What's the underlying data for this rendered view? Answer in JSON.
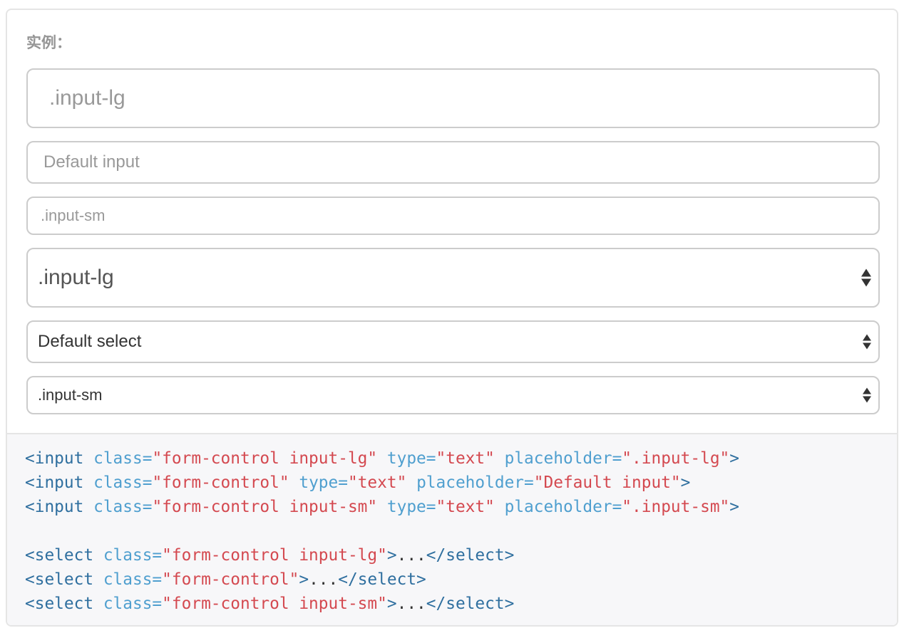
{
  "example": {
    "label": "实例："
  },
  "inputs": [
    {
      "placeholder": ".input-lg",
      "value": ""
    },
    {
      "placeholder": "Default input",
      "value": ""
    },
    {
      "placeholder": ".input-sm",
      "value": ""
    }
  ],
  "selects": [
    {
      "selected": ".input-lg"
    },
    {
      "selected": "Default select"
    },
    {
      "selected": ".input-sm"
    }
  ],
  "code": {
    "line1": {
      "open": "<input",
      "attr1": "class=",
      "val1": "\"form-control input-lg\"",
      "attr2": "type=",
      "val2": "\"text\"",
      "attr3": "placeholder=",
      "val3": "\".input-lg\"",
      "close": ">"
    },
    "line2": {
      "open": "<input",
      "attr1": "class=",
      "val1": "\"form-control\"",
      "attr2": "type=",
      "val2": "\"text\"",
      "attr3": "placeholder=",
      "val3": "\"Default input\"",
      "close": ">"
    },
    "line3": {
      "open": "<input",
      "attr1": "class=",
      "val1": "\"form-control input-sm\"",
      "attr2": "type=",
      "val2": "\"text\"",
      "attr3": "placeholder=",
      "val3": "\".input-sm\"",
      "close": ">"
    },
    "line4": {
      "open": "<select",
      "attr1": "class=",
      "val1": "\"form-control input-lg\"",
      "close": ">",
      "text": "...",
      "end": "</select>"
    },
    "line5": {
      "open": "<select",
      "attr1": "class=",
      "val1": "\"form-control\"",
      "close": ">",
      "text": "...",
      "end": "</select>"
    },
    "line6": {
      "open": "<select",
      "attr1": "class=",
      "val1": "\"form-control input-sm\"",
      "close": ">",
      "text": "...",
      "end": "</select>"
    }
  },
  "colors": {
    "tag": "#2f6f9f",
    "attribute": "#4f9fcf",
    "string": "#d44950",
    "placeholder": "#999999",
    "border": "#cccccc",
    "code_background": "#f7f7f9"
  }
}
